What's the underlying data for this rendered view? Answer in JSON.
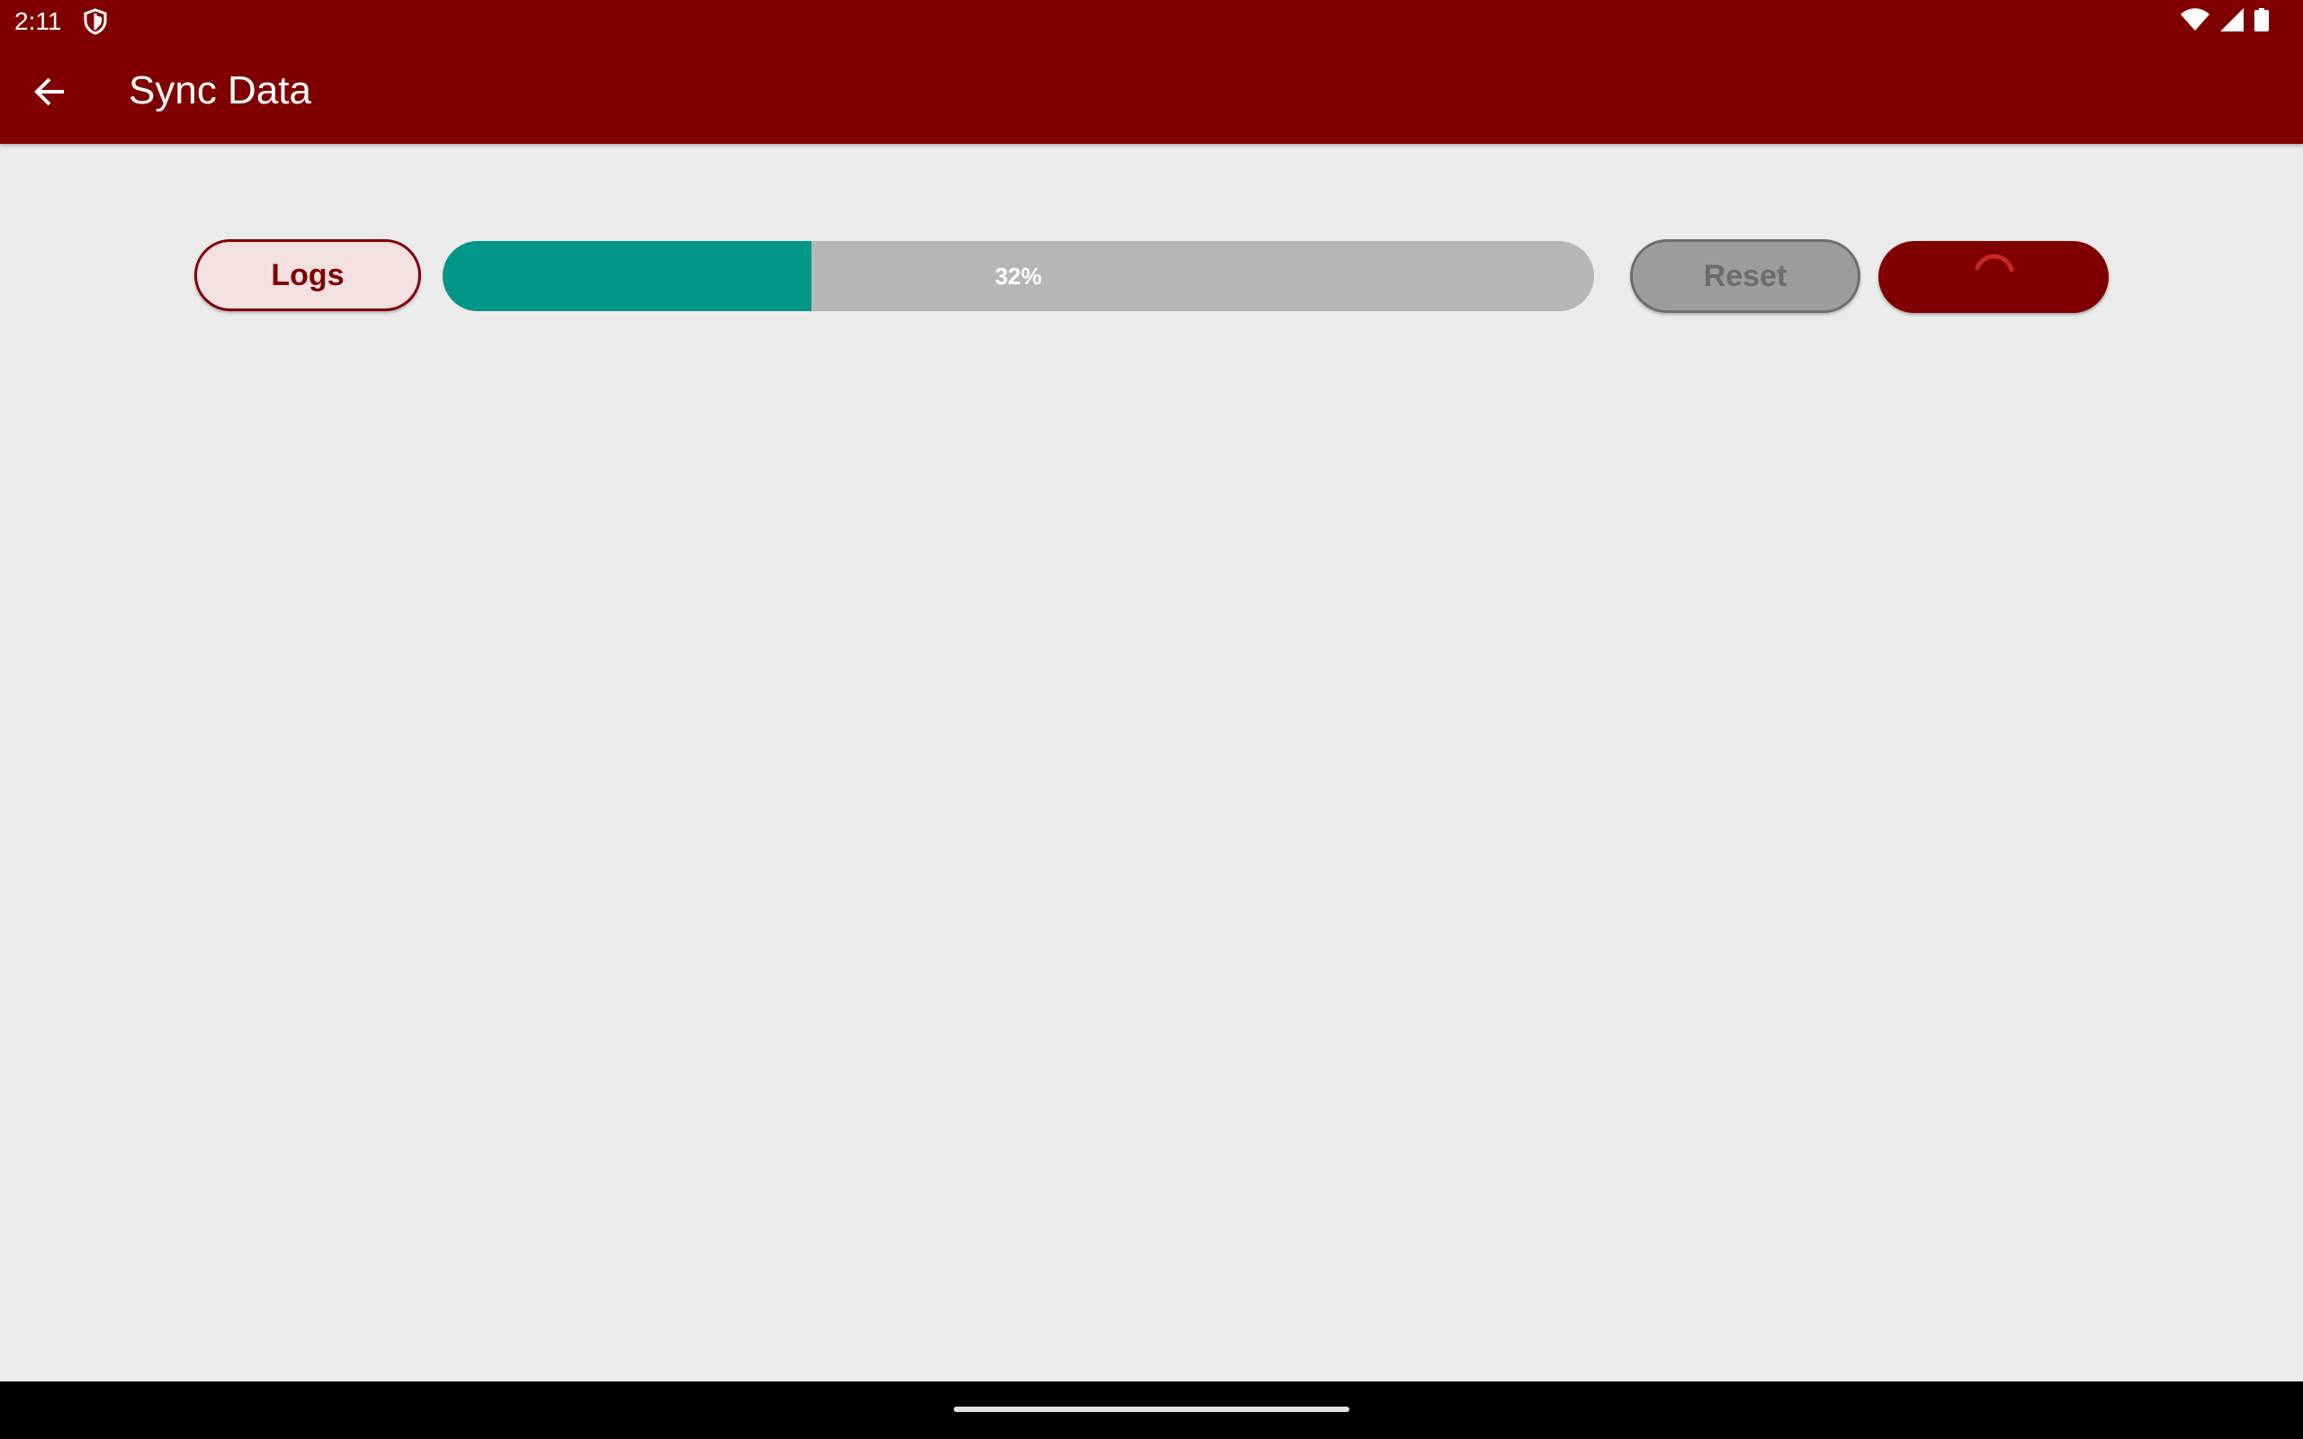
{
  "status_bar": {
    "time": "2:11",
    "icons": [
      "shield-icon",
      "wifi-icon",
      "signal-icon",
      "battery-icon"
    ]
  },
  "app_bar": {
    "title": "Sync Data",
    "back_icon": "arrow-back-icon"
  },
  "controls": {
    "logs_label": "Logs",
    "progress_value": 32,
    "progress_text": "32%",
    "reset_label": "Reset",
    "sync_state": "loading"
  },
  "colors": {
    "brand": "#800000",
    "progress_fill": "#009688",
    "progress_track": "#b6b6b6",
    "background": "#ebebeb"
  }
}
